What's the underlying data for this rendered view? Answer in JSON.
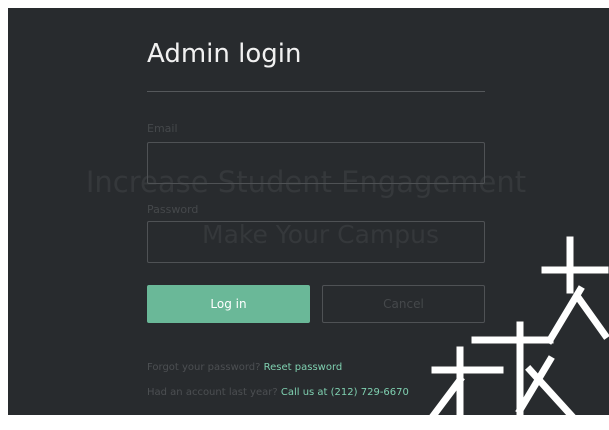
{
  "background": {
    "headline": "Increase Student Engagement",
    "subheadline": "Make Your Campus"
  },
  "modal": {
    "title": "Admin login",
    "email_label": "Email",
    "email_value": "",
    "password_label": "Password",
    "password_value": "",
    "login_label": "Log in",
    "cancel_label": "Cancel",
    "forgot_text": "Forgot your password?",
    "reset_link": "Reset password",
    "account_text": "Had an account last year?",
    "call_link": "Call us at (212) 729-6670"
  },
  "colors": {
    "screen_bg": "#282b2e",
    "accent": "#6ab898",
    "link": "#7fd0b0"
  },
  "icons": [
    "watermark-glyph"
  ]
}
